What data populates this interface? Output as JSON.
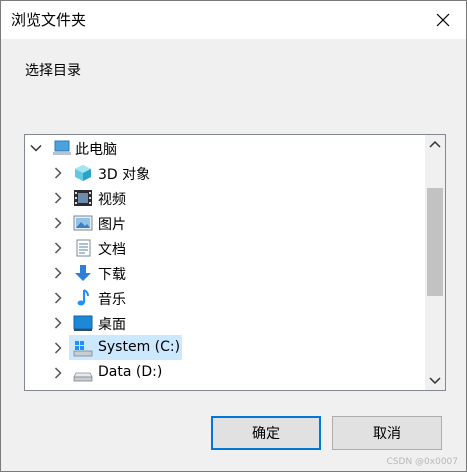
{
  "window": {
    "title": "浏览文件夹",
    "close_icon": "close-icon"
  },
  "prompt": "选择目录",
  "tree": {
    "items": [
      {
        "label": "此电脑",
        "icon": "computer-icon",
        "expanded": true,
        "level": 0
      },
      {
        "label": "3D 对象",
        "icon": "3d-objects-icon",
        "expanded": false,
        "level": 1
      },
      {
        "label": "视频",
        "icon": "video-icon",
        "expanded": false,
        "level": 1
      },
      {
        "label": "图片",
        "icon": "pictures-icon",
        "expanded": false,
        "level": 1
      },
      {
        "label": "文档",
        "icon": "documents-icon",
        "expanded": false,
        "level": 1
      },
      {
        "label": "下载",
        "icon": "downloads-icon",
        "expanded": false,
        "level": 1
      },
      {
        "label": "音乐",
        "icon": "music-icon",
        "expanded": false,
        "level": 1
      },
      {
        "label": "桌面",
        "icon": "desktop-icon",
        "expanded": false,
        "level": 1
      },
      {
        "label": "System (C:)",
        "icon": "system-drive-icon",
        "expanded": false,
        "level": 1,
        "selected": true
      },
      {
        "label": "Data (D:)",
        "icon": "drive-icon",
        "expanded": false,
        "level": 1
      }
    ]
  },
  "buttons": {
    "ok": "确定",
    "cancel": "取消"
  },
  "watermark": "CSDN @0x0007",
  "colors": {
    "selection": "#cce8ff",
    "accent_border": "#0078d7",
    "folder_blue": "#1e90ff"
  }
}
